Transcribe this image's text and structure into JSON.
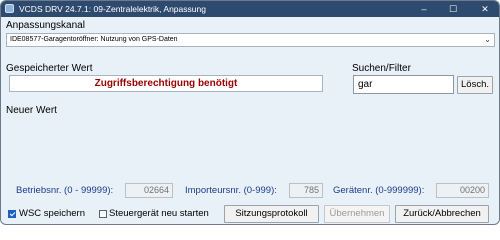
{
  "window": {
    "title": "VCDS DRV 24.7.1: 09-Zentralelektrik,  Anpassung",
    "minimize": "–",
    "maximize": "☐",
    "close": "✕",
    "icon": "vcds-app-icon"
  },
  "channel": {
    "label": "Anpassungskanal",
    "selected": "IDE08577-Garagentoröffner: Nutzung von GPS-Daten",
    "arrow": "⌄"
  },
  "stored_value": {
    "label": "Gespeicherter Wert",
    "value": "Zugriffsberechtigung benötigt"
  },
  "search": {
    "label": "Suchen/Filter",
    "value": "gar",
    "clear_label": "Lösch."
  },
  "new_value": {
    "label": "Neuer Wert"
  },
  "numbers": {
    "betrieb_label": "Betriebsnr. (0 - 99999):",
    "betrieb_value": "02664",
    "importeur_label": "Importeursnr. (0-999):",
    "importeur_value": "785",
    "geraet_label": "Gerätenr. (0-999999):",
    "geraet_value": "00200"
  },
  "options": {
    "wsc_label": "WSC speichern",
    "wsc_checked": true,
    "restart_label": "Steuergerät neu starten",
    "restart_checked": false
  },
  "buttons": {
    "session_log": "Sitzungsprotokoll",
    "apply": "Übernehmen",
    "back": "Zurück/Abbrechen"
  },
  "colors": {
    "title_bar": "#2e4a6e",
    "error_text": "#9b0000",
    "number_labels": "#1c3d8c",
    "background": "#e8f0f8"
  }
}
